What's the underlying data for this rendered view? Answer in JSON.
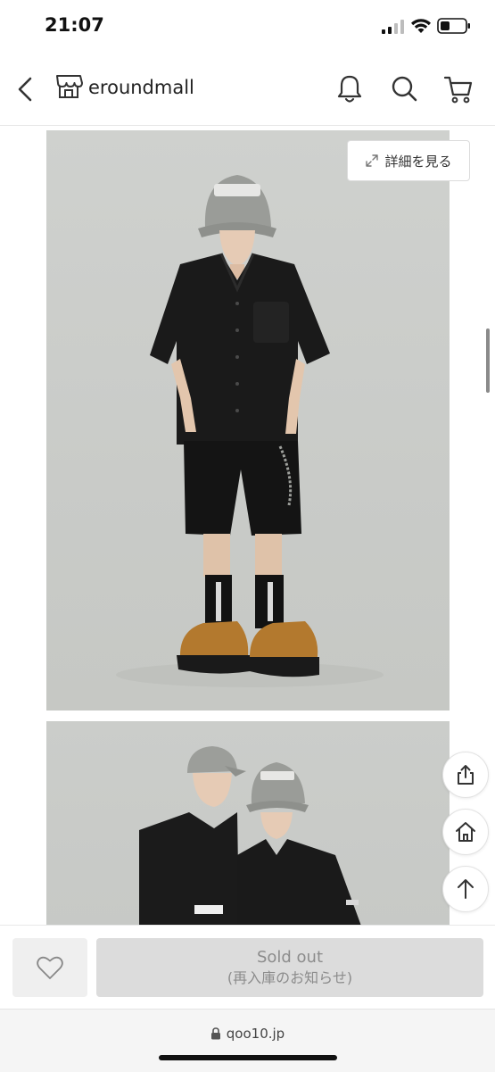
{
  "status_bar": {
    "time": "21:07"
  },
  "header": {
    "shop_name": "eroundmall"
  },
  "gallery": {
    "detail_button_label": "詳細を見る"
  },
  "bottom_bar": {
    "sold_out_label": "Sold out",
    "restock_label": "(再入庫のお知らせ)"
  },
  "browser": {
    "url": "qoo10.jp"
  },
  "icons": {
    "back": "chevron-left-icon",
    "store": "store-icon",
    "bell": "bell-icon",
    "search": "search-icon",
    "cart": "cart-icon",
    "expand": "expand-icon",
    "share": "share-icon",
    "home": "home-icon",
    "top": "arrow-up-icon",
    "wish": "heart-icon",
    "lock": "lock-icon"
  },
  "colors": {
    "sold_out_bg": "#dcdcdc",
    "sold_out_text": "#8c8c8c"
  }
}
